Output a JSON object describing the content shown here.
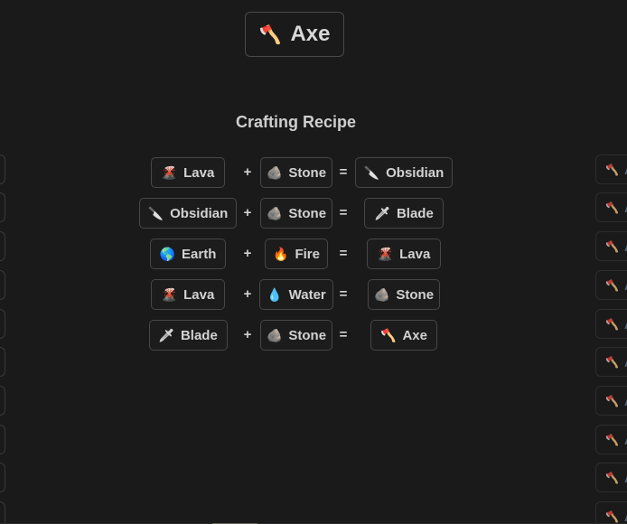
{
  "hero": {
    "icon": "axe-icon",
    "emoji": "🪓",
    "label": "Axe"
  },
  "title": "Crafting Recipe",
  "operators": {
    "plus": "+",
    "equals": "="
  },
  "recipes": [
    {
      "a": {
        "emoji": "🌋",
        "label": "Lava"
      },
      "b": {
        "emoji": "🪨",
        "label": "Stone"
      },
      "result": {
        "emoji": "🔪",
        "label": "Obsidian"
      }
    },
    {
      "a": {
        "emoji": "🔪",
        "label": "Obsidian"
      },
      "b": {
        "emoji": "🪨",
        "label": "Stone"
      },
      "result": {
        "emoji": "🗡",
        "label": "Blade"
      }
    },
    {
      "a": {
        "emoji": "🌎",
        "label": "Earth"
      },
      "b": {
        "emoji": "🔥",
        "label": "Fire"
      },
      "result": {
        "emoji": "🌋",
        "label": "Lava"
      }
    },
    {
      "a": {
        "emoji": "🌋",
        "label": "Lava"
      },
      "b": {
        "emoji": "💧",
        "label": "Water"
      },
      "result": {
        "emoji": "🪨",
        "label": "Stone"
      }
    },
    {
      "a": {
        "emoji": "🗡",
        "label": "Blade"
      },
      "b": {
        "emoji": "🪨",
        "label": "Stone"
      },
      "result": {
        "emoji": "🪓",
        "label": "Axe"
      }
    }
  ],
  "sidebar_right": {
    "items": [
      {
        "emoji": "🪓",
        "label": "Axe"
      },
      {
        "emoji": "🪓",
        "label": "Axe"
      },
      {
        "emoji": "🪓",
        "label": "Axe"
      },
      {
        "emoji": "🪓",
        "label": "Axe"
      },
      {
        "emoji": "🪓",
        "label": "Axe"
      },
      {
        "emoji": "🪓",
        "label": "Axe"
      },
      {
        "emoji": "🪓",
        "label": "Axe"
      },
      {
        "emoji": "🪓",
        "label": "Axe"
      },
      {
        "emoji": "🪓",
        "label": "Axe"
      },
      {
        "emoji": "🪓",
        "label": "Axe"
      }
    ]
  },
  "sidebar_left": {
    "count": 10
  }
}
